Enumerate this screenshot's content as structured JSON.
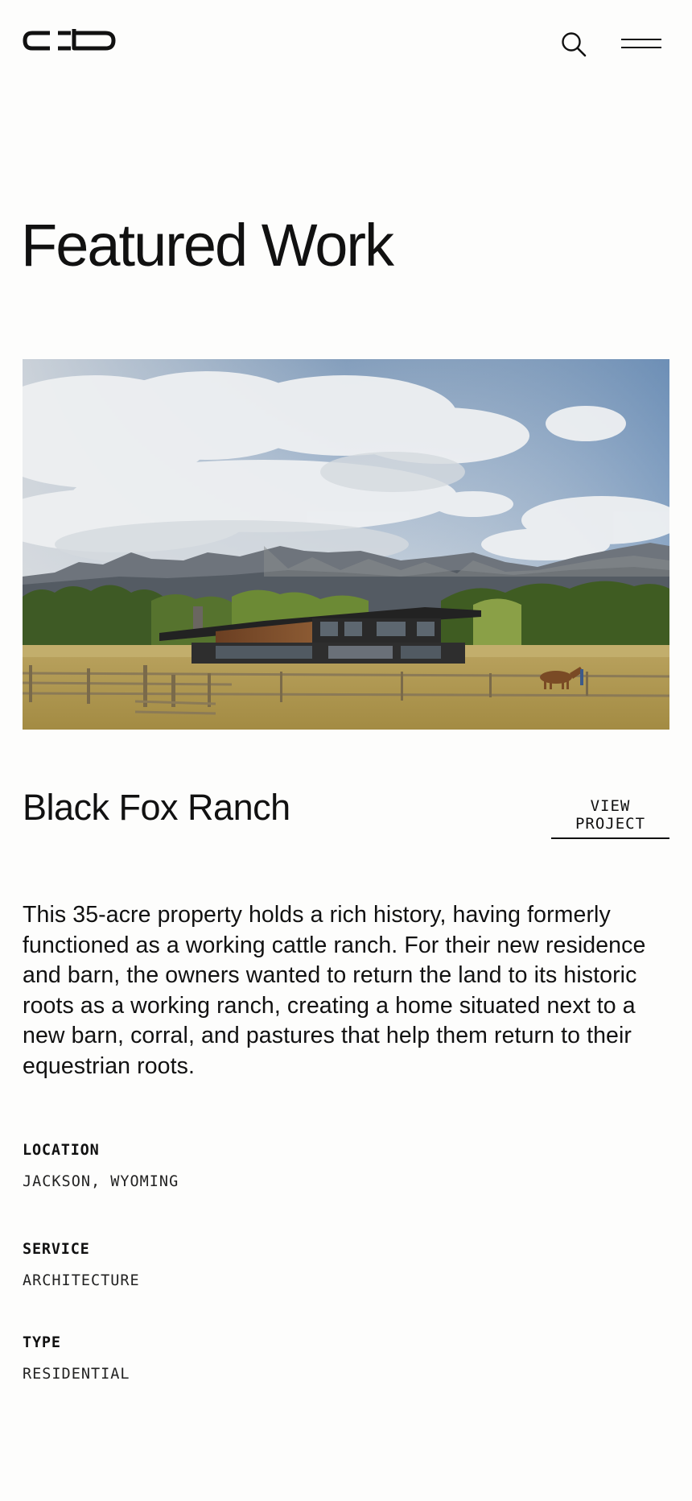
{
  "header": {
    "logo_text": "clb",
    "search_icon": "search-icon",
    "menu_icon": "hamburger-menu-icon"
  },
  "page": {
    "title": "Featured Work"
  },
  "project": {
    "name": "Black Fox Ranch",
    "view_label": "VIEW PROJECT",
    "description": "This 35-acre property holds a rich history, having formerly functioned as a working cattle ranch. For their new residence and barn, the owners wanted to return the land to its historic roots as a working ranch, creating a home situated next to a new barn, corral, and pastures that help them return to their equestrian roots.",
    "details": [
      {
        "label": "LOCATION",
        "value": "JACKSON, WYOMING"
      },
      {
        "label": "SERVICE",
        "value": "ARCHITECTURE"
      },
      {
        "label": "TYPE",
        "value": "RESIDENTIAL"
      }
    ]
  },
  "colors": {
    "background": "#fdfdfc",
    "text": "#111111"
  }
}
